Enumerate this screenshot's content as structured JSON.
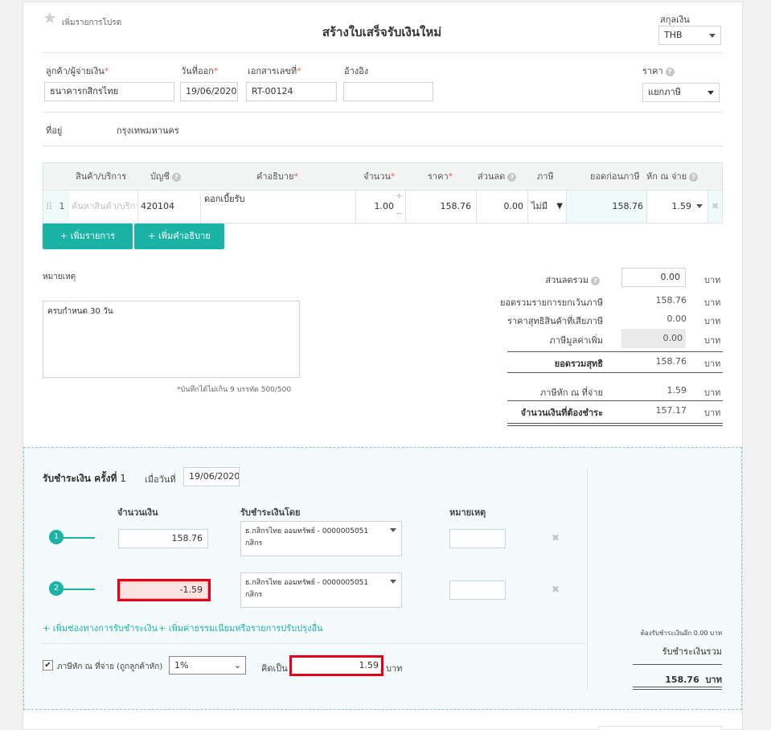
{
  "header": {
    "favorite_label": "เพิ่มรายการโปรด",
    "title": "สร้างใบเสร็จรับเงินใหม่",
    "currency_label": "สกุลเงิน",
    "currency_value": "THB"
  },
  "form": {
    "customer_label": "ลูกค้า/ผู้จ่ายเงิน",
    "customer_value": "ธนาคารกสิกรไทย",
    "date_label": "วันที่ออก",
    "date_value": "19/06/2020",
    "docno_label": "เอกสารเลขที่",
    "docno_value": "RT-00124",
    "ref_label": "อ้างอิง",
    "ref_value": "",
    "price_label": "ราคา",
    "price_value": "แยกภาษี",
    "address_label": "ที่อยู่",
    "address_value": "กรุงเทพมหานคร",
    "required_mark": "*"
  },
  "table": {
    "headers": {
      "product": "สินค้า/บริการ",
      "account": "บัญชี",
      "description": "คำอธิบาย",
      "qty": "จำนวน",
      "price": "ราคา",
      "discount": "ส่วนลด",
      "tax": "ภาษี",
      "pretax": "ยอดก่อนภาษี",
      "wht": "หัก ณ จ่าย"
    },
    "row": {
      "num": "1",
      "product_placeholder": "ค้นหาสินค้า/บริการ",
      "account": "420104",
      "description": "ดอกเบี้ยรับ",
      "qty": "1.00",
      "price": "158.76",
      "discount": "0.00",
      "tax": "ไม่มี",
      "pretax": "158.76",
      "wht": "1.59"
    },
    "add_row_label": "+ เพิ่มรายการ",
    "add_desc_label": "+ เพิ่มคำอธิบาย"
  },
  "notes": {
    "label": "หมายเหตุ",
    "value": "ครบกำหนด 30 วัน",
    "hint": "*บันทึกได้ไม่เกิน 9 บรรทัด 500/500"
  },
  "summary": {
    "discount_label": "ส่วนลดรวม",
    "discount_value": "0.00",
    "exempt_label": "ยอดรวมรายการยกเว้นภาษี",
    "exempt_value": "158.76",
    "taxable_label": "ราคาสุทธิสินค้าที่เสียภาษี",
    "taxable_value": "0.00",
    "vat_label": "ภาษีมูลค่าเพิ่ม",
    "vat_value": "0.00",
    "net_label": "ยอดรวมสุทธิ",
    "net_value": "158.76",
    "wht_label": "ภาษีหัก ณ ที่จ่าย",
    "wht_value": "1.59",
    "due_label": "จำนวนเงินที่ต้องชำระ",
    "due_value": "157.17",
    "unit": "บาท"
  },
  "payment": {
    "title": "รับชำระเงิน ครั้งที่",
    "number": "1",
    "date_label": "เมื่อวันที่",
    "date_value": "19/06/2020",
    "amount_header": "จำนวนเงิน",
    "method_header": "รับชำระเงินโดย",
    "note_header": "หมายเหตุ",
    "rows": [
      {
        "num": "1",
        "amount": "158.76",
        "method_line1": "ธ.กสิกรไทย ออมทรัพย์ - 0000005051",
        "method_line2": "กสิกร"
      },
      {
        "num": "2",
        "amount": "-1.59",
        "method_line1": "ธ.กสิกรไทย ออมทรัพย์ - 0000005051",
        "method_line2": "กสิกร"
      }
    ],
    "add_channel_link": "+ เพิ่มช่องทางการรับชำระเงิน",
    "add_fee_link": "+ เพิ่มค่าธรรมเนียมหรือรายการปรับปรุงอื่น",
    "wht_checkbox_label": "ภาษีหัก ณ ที่จ่าย (ถูกลูกค้าหัก)",
    "wht_rate": "1%",
    "calc_label": "คิดเป็น",
    "calc_value": "1.59",
    "calc_unit": "บาท",
    "remaining_label": "ต้องรับชำระเงินอีก 0.00 บาท",
    "total_label": "รับชำระเงินรวม",
    "total_value": "158.76",
    "total_unit": "บาท"
  },
  "colors": {
    "accent": "#1ab3a6",
    "highlight_border": "#e3001b",
    "negative_bg": "#fde2e2"
  }
}
